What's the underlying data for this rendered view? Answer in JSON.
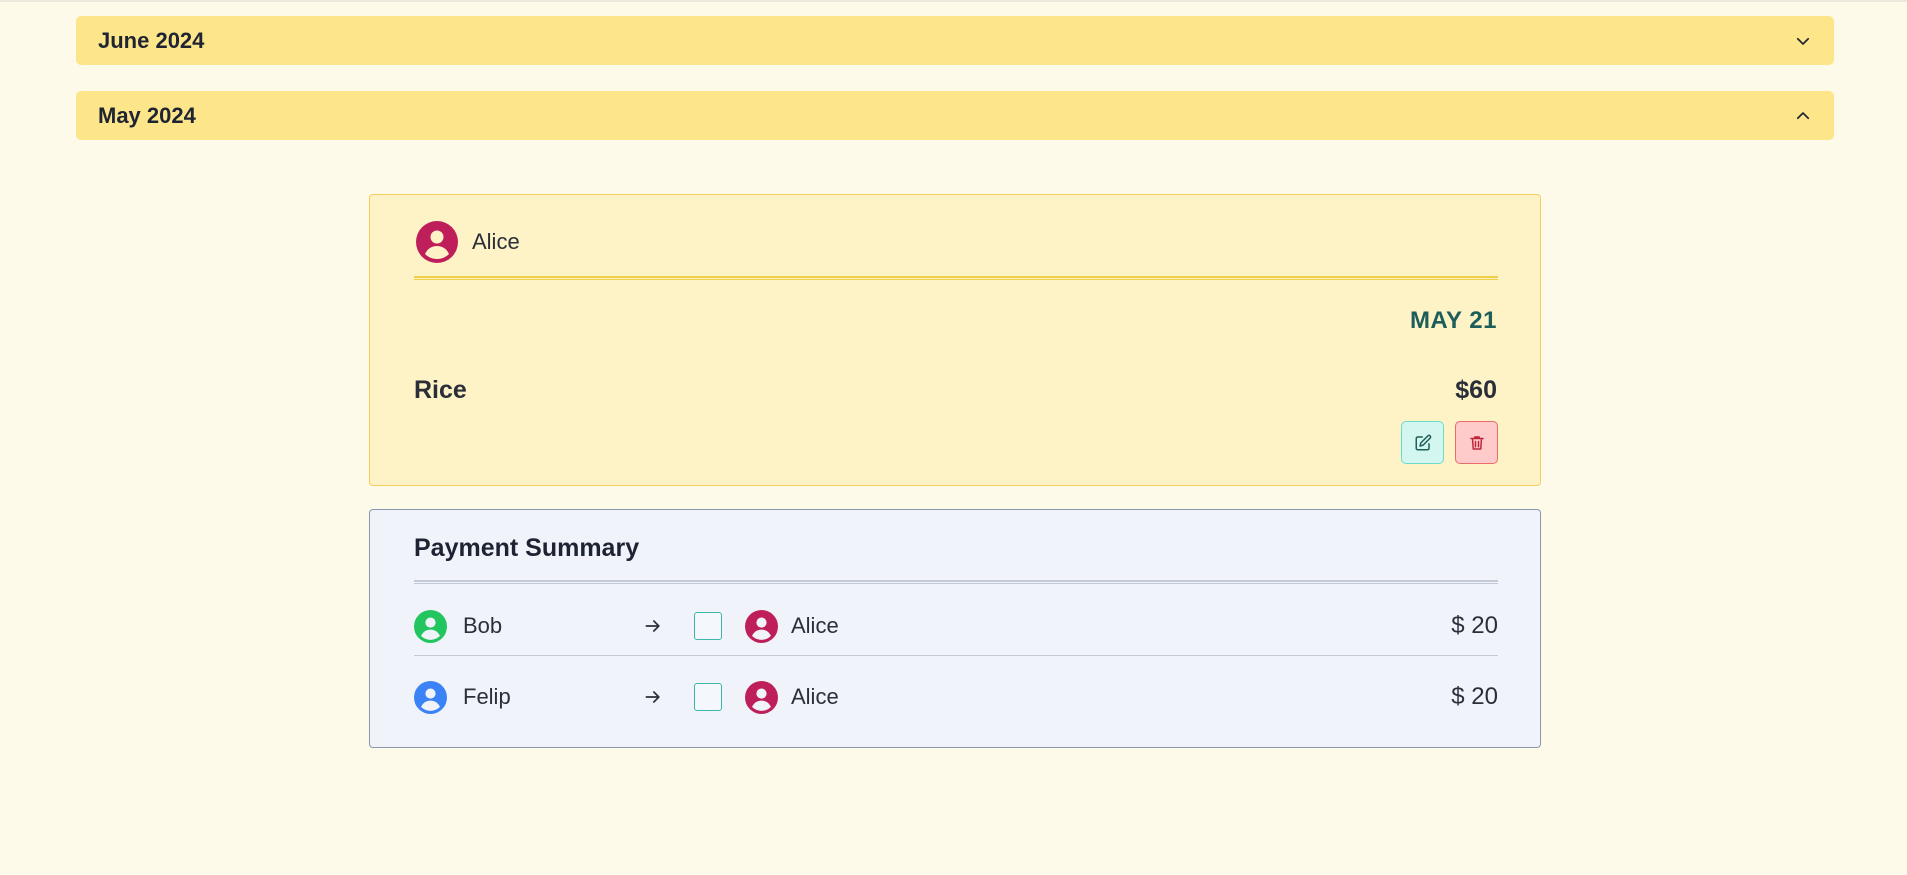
{
  "accordions": [
    {
      "label": "June 2024",
      "expanded": false
    },
    {
      "label": "May 2024",
      "expanded": true
    }
  ],
  "expense": {
    "payer": {
      "name": "Alice",
      "avatar_color": "#be1e5a"
    },
    "date": "MAY 21",
    "item": "Rice",
    "amount": "$60",
    "edit_icon": "edit-icon",
    "delete_icon": "trash-icon"
  },
  "summary": {
    "title": "Payment Summary",
    "rows": [
      {
        "from": "Bob",
        "from_color": "#22c55e",
        "to": "Alice",
        "to_color": "#be1e5a",
        "amount": "$ 20",
        "settled": false
      },
      {
        "from": "Felip",
        "from_color": "#3b82f6",
        "to": "Alice",
        "to_color": "#be1e5a",
        "amount": "$ 20",
        "settled": false
      }
    ]
  },
  "colors": {
    "background": "#fefaea",
    "accordion": "#fde68a",
    "expense_card": "#fef3c6",
    "summary_card": "#f0f3fa",
    "date_accent": "#1d5e5a"
  }
}
